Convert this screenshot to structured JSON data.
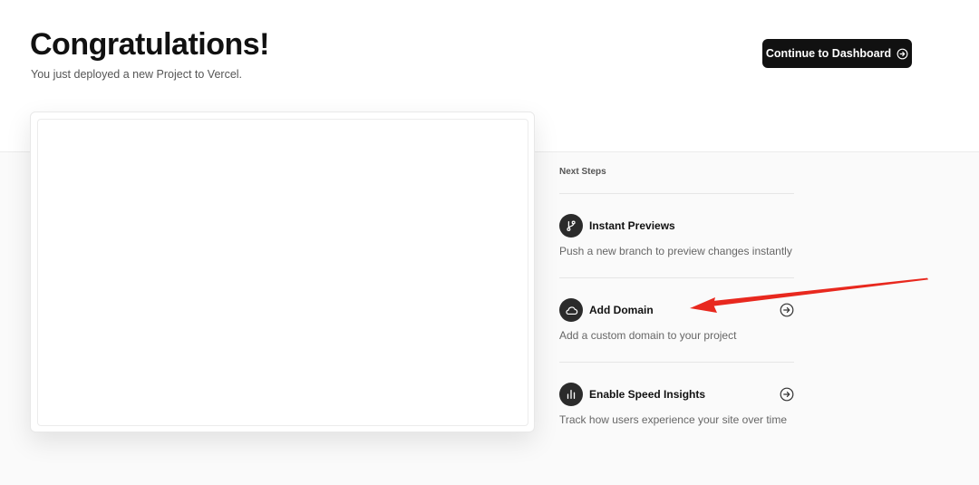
{
  "header": {
    "title": "Congratulations!",
    "subtitle": "You just deployed a new Project to Vercel.",
    "dashboard_button": "Continue to Dashboard"
  },
  "next_steps": {
    "heading": "Next Steps",
    "items": [
      {
        "title": "Instant Previews",
        "description": "Push a new branch to preview changes instantly",
        "icon": "git-branch-icon"
      },
      {
        "title": "Add Domain",
        "description": "Add a custom domain to your project",
        "icon": "cloud-icon"
      },
      {
        "title": "Enable Speed Insights",
        "description": "Track how users experience your site over time",
        "icon": "bar-chart-icon"
      }
    ]
  },
  "colors": {
    "button_bg": "#111111",
    "icon_bg": "#2b2b2b",
    "annotation_arrow": "#e8281e"
  }
}
